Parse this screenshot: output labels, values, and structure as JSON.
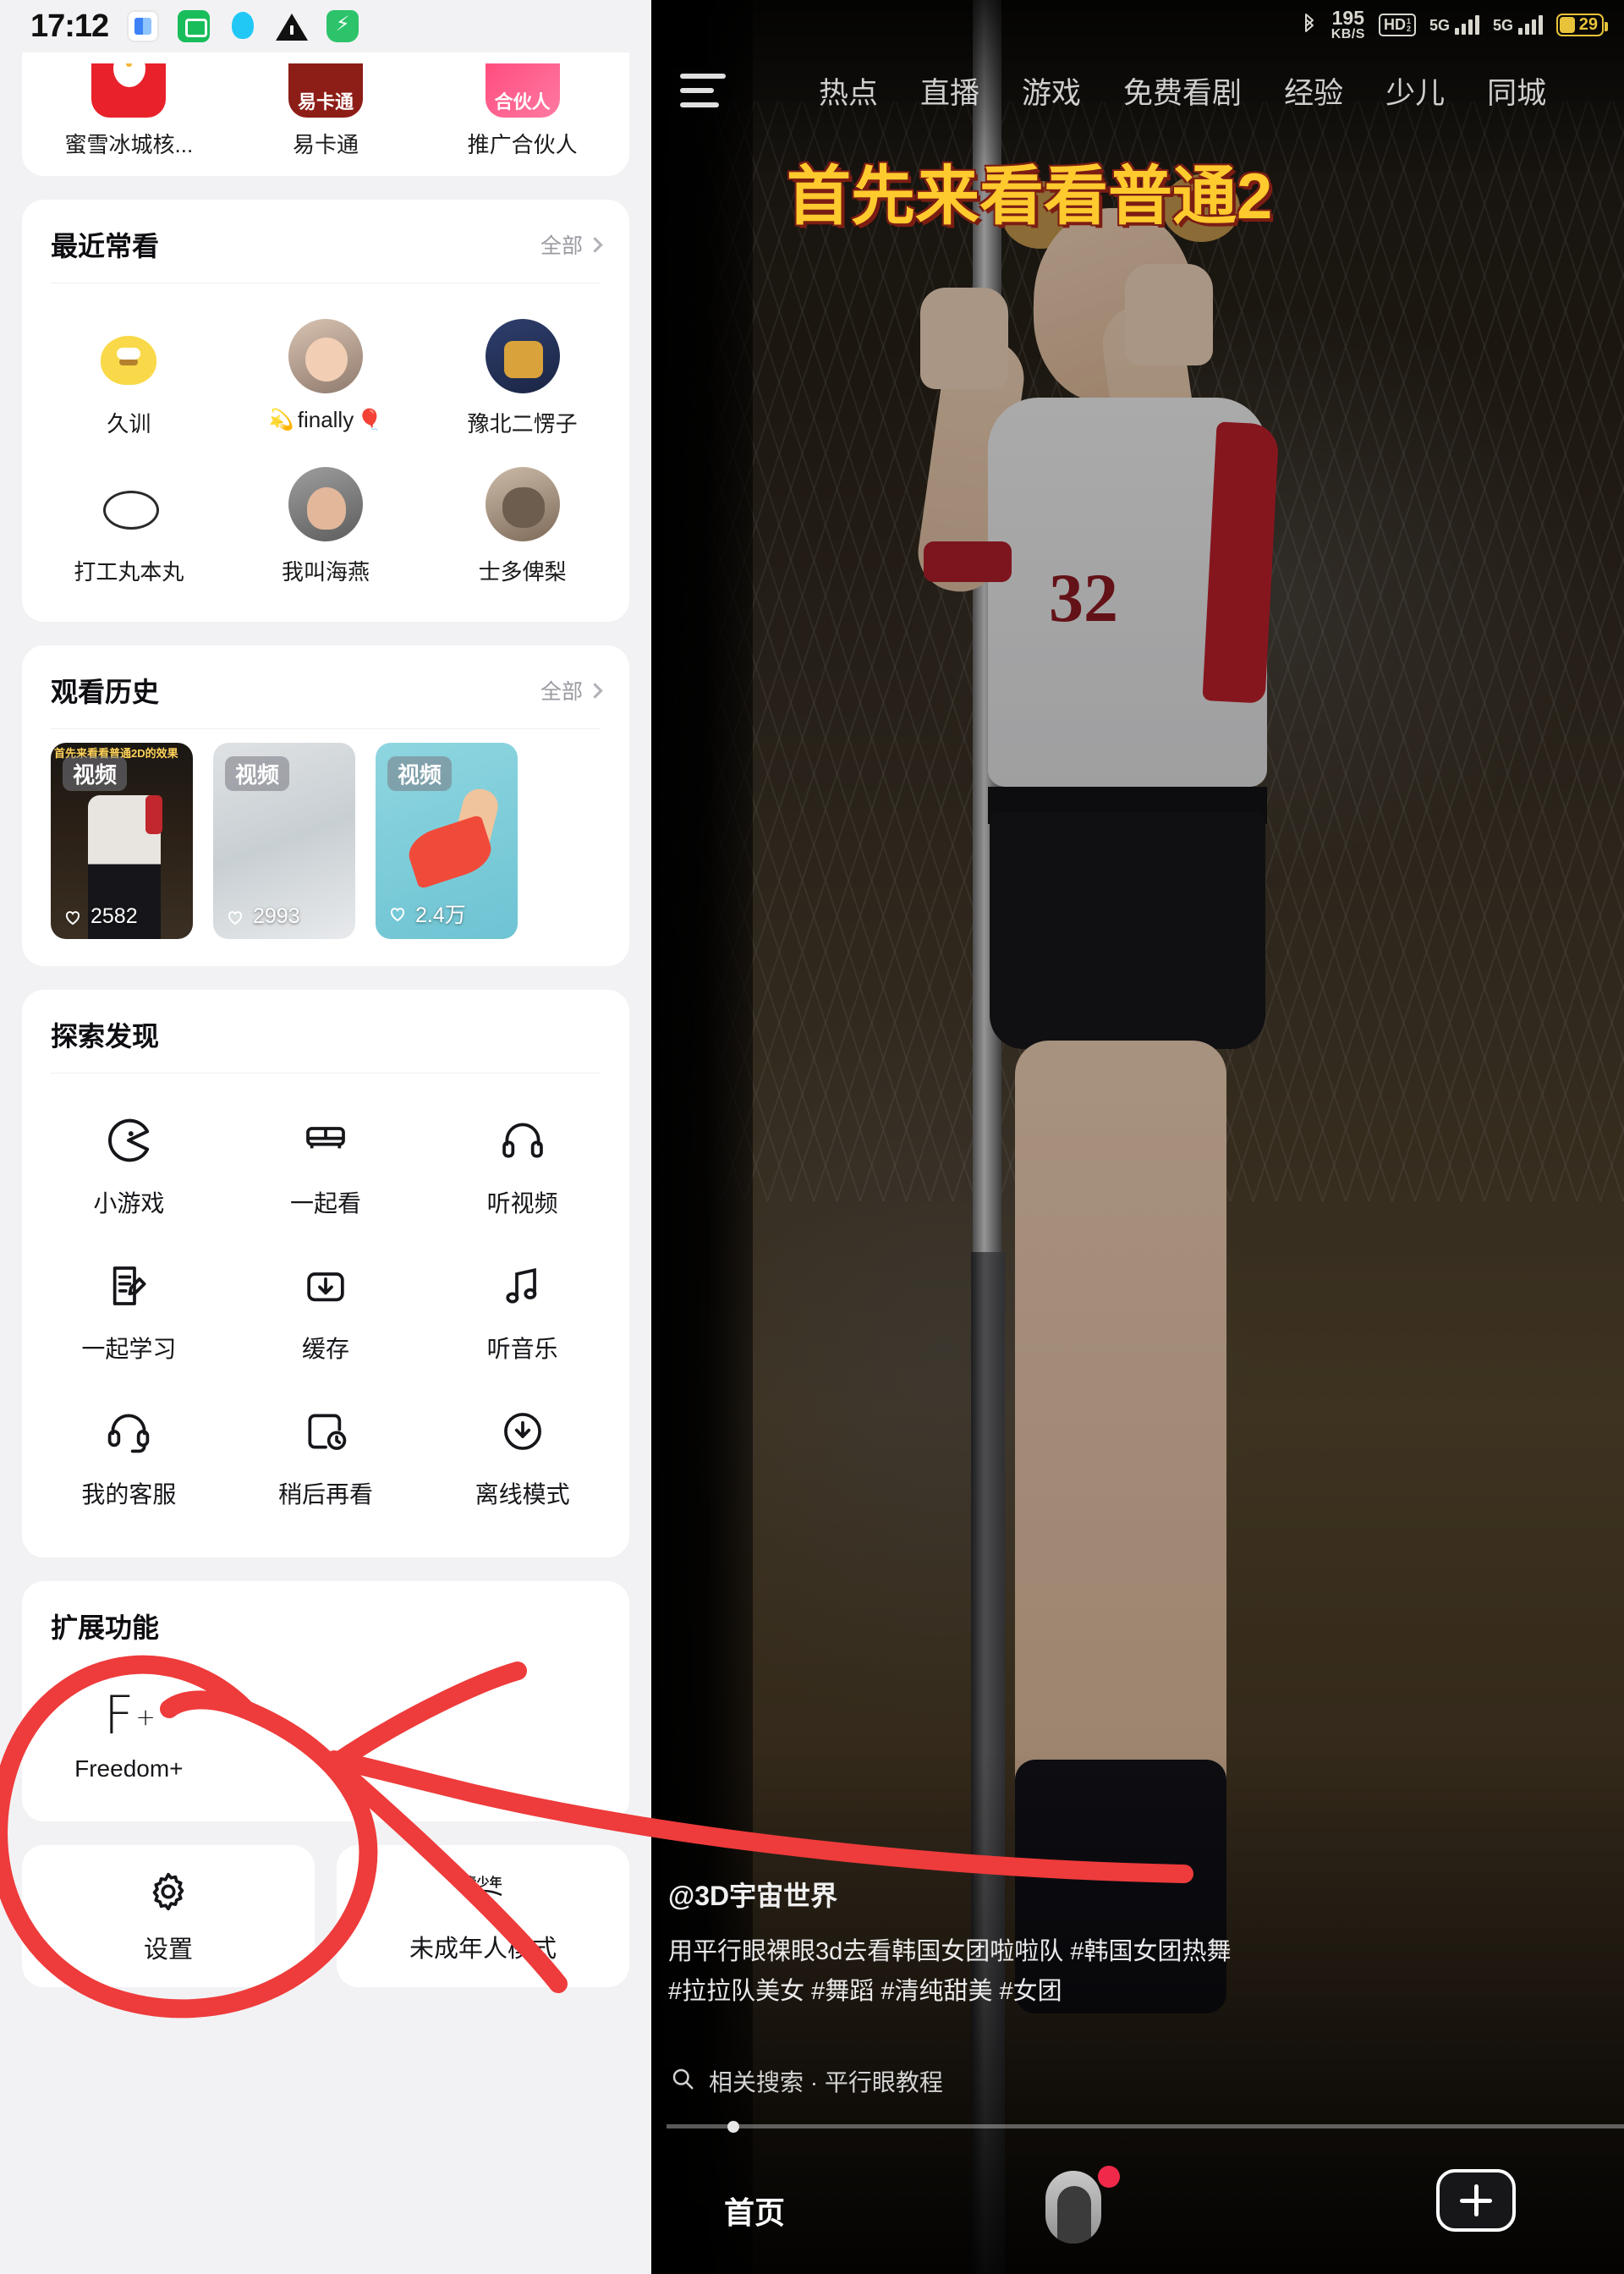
{
  "status_bar": {
    "clock": "17:12",
    "left_icons": [
      "app-blue-icon",
      "messages-icon",
      "qq-icon",
      "warning-icon",
      "security-shield-icon"
    ],
    "right": {
      "bluetooth": "bluetooth-icon",
      "net_speed_value": "195",
      "net_speed_unit": "KB/S",
      "hd_badge": "HD",
      "hd_sub_top": "1",
      "hd_sub_bottom": "2",
      "sim1_label": "5G",
      "sim2_label": "5G",
      "battery_percent": "29"
    }
  },
  "drawer": {
    "app_shortcuts": [
      {
        "label": "蜜雪冰城核...",
        "icon": "mixue-app-icon"
      },
      {
        "label": "易卡通",
        "icon": "yikatong-app-icon",
        "badge": "易卡通"
      },
      {
        "label": "推广合伙人",
        "icon": "partner-app-icon",
        "badge": "合伙人"
      }
    ],
    "recent_watched": {
      "title": "最近常看",
      "more": "全部",
      "users": [
        {
          "name": "久训",
          "avatar": "duck-avatar"
        },
        {
          "name": "finally",
          "prefix_emoji": "💫",
          "suffix_emoji": "🎈",
          "avatar": "baby-avatar"
        },
        {
          "name": "豫北二愣子",
          "avatar": "toy-avatar"
        },
        {
          "name": "打工丸本丸",
          "avatar": "cat-avatar"
        },
        {
          "name": "我叫海燕",
          "avatar": "woman-avatar"
        },
        {
          "name": "士多俾梨",
          "avatar": "dog-avatar"
        }
      ]
    },
    "watch_history": {
      "title": "观看历史",
      "more": "全部",
      "items": [
        {
          "badge": "视频",
          "overlay_title": "首先来看看普通2D的效果",
          "likes": "2582"
        },
        {
          "badge": "视频",
          "overlay_title": "",
          "likes": "2993"
        },
        {
          "badge": "视频",
          "overlay_title": "",
          "likes": "2.4万"
        }
      ]
    },
    "explore": {
      "title": "探索发现",
      "items": [
        {
          "label": "小游戏",
          "icon": "pacman-icon"
        },
        {
          "label": "一起看",
          "icon": "sofa-icon"
        },
        {
          "label": "听视频",
          "icon": "headphones-icon"
        },
        {
          "label": "一起学习",
          "icon": "note-pencil-icon"
        },
        {
          "label": "缓存",
          "icon": "download-box-icon"
        },
        {
          "label": "听音乐",
          "icon": "music-note-icon"
        },
        {
          "label": "我的客服",
          "icon": "support-headset-icon"
        },
        {
          "label": "稍后再看",
          "icon": "watch-later-icon"
        },
        {
          "label": "离线模式",
          "icon": "offline-cloud-icon"
        }
      ]
    },
    "extensions": {
      "title": "扩展功能",
      "items": [
        {
          "label": "Freedom+",
          "glyph": "F",
          "glyph_sup": "+",
          "icon": "freedom-plus-icon"
        }
      ]
    },
    "bottom_buttons": [
      {
        "label": "设置",
        "icon": "gear-icon"
      },
      {
        "label": "未成年人模式",
        "icon": "minor-mode-icon"
      }
    ]
  },
  "video": {
    "nav_tabs": [
      {
        "label": "热点",
        "active": false
      },
      {
        "label": "直播",
        "active": false
      },
      {
        "label": "游戏",
        "active": false
      },
      {
        "label": "免费看剧",
        "active": false
      },
      {
        "label": "经验",
        "active": false
      },
      {
        "label": "少儿",
        "active": false
      },
      {
        "label": "同城",
        "active": false
      }
    ],
    "menu_icon": "hamburger-menu-icon",
    "subtitle_overlay": "首先来看看普通2",
    "author": "@3D宇宙世界",
    "description_line1": "用平行眼裸眼3d去看韩国女团啦啦队 #韩国女团热舞",
    "description_line2": "#拉拉队美女 #舞蹈 #清纯甜美 #女团",
    "related_search": "相关搜索 · 平行眼教程",
    "search_icon": "search-icon",
    "bottom_tab_home": "首页",
    "avatar_icon": "profile-avatar",
    "plus_button": "add-post-button",
    "jersey_number": "32"
  },
  "annotation": {
    "color": "#ee3b3b",
    "shapes": [
      "circle-highlight",
      "arrow-pointer"
    ]
  }
}
